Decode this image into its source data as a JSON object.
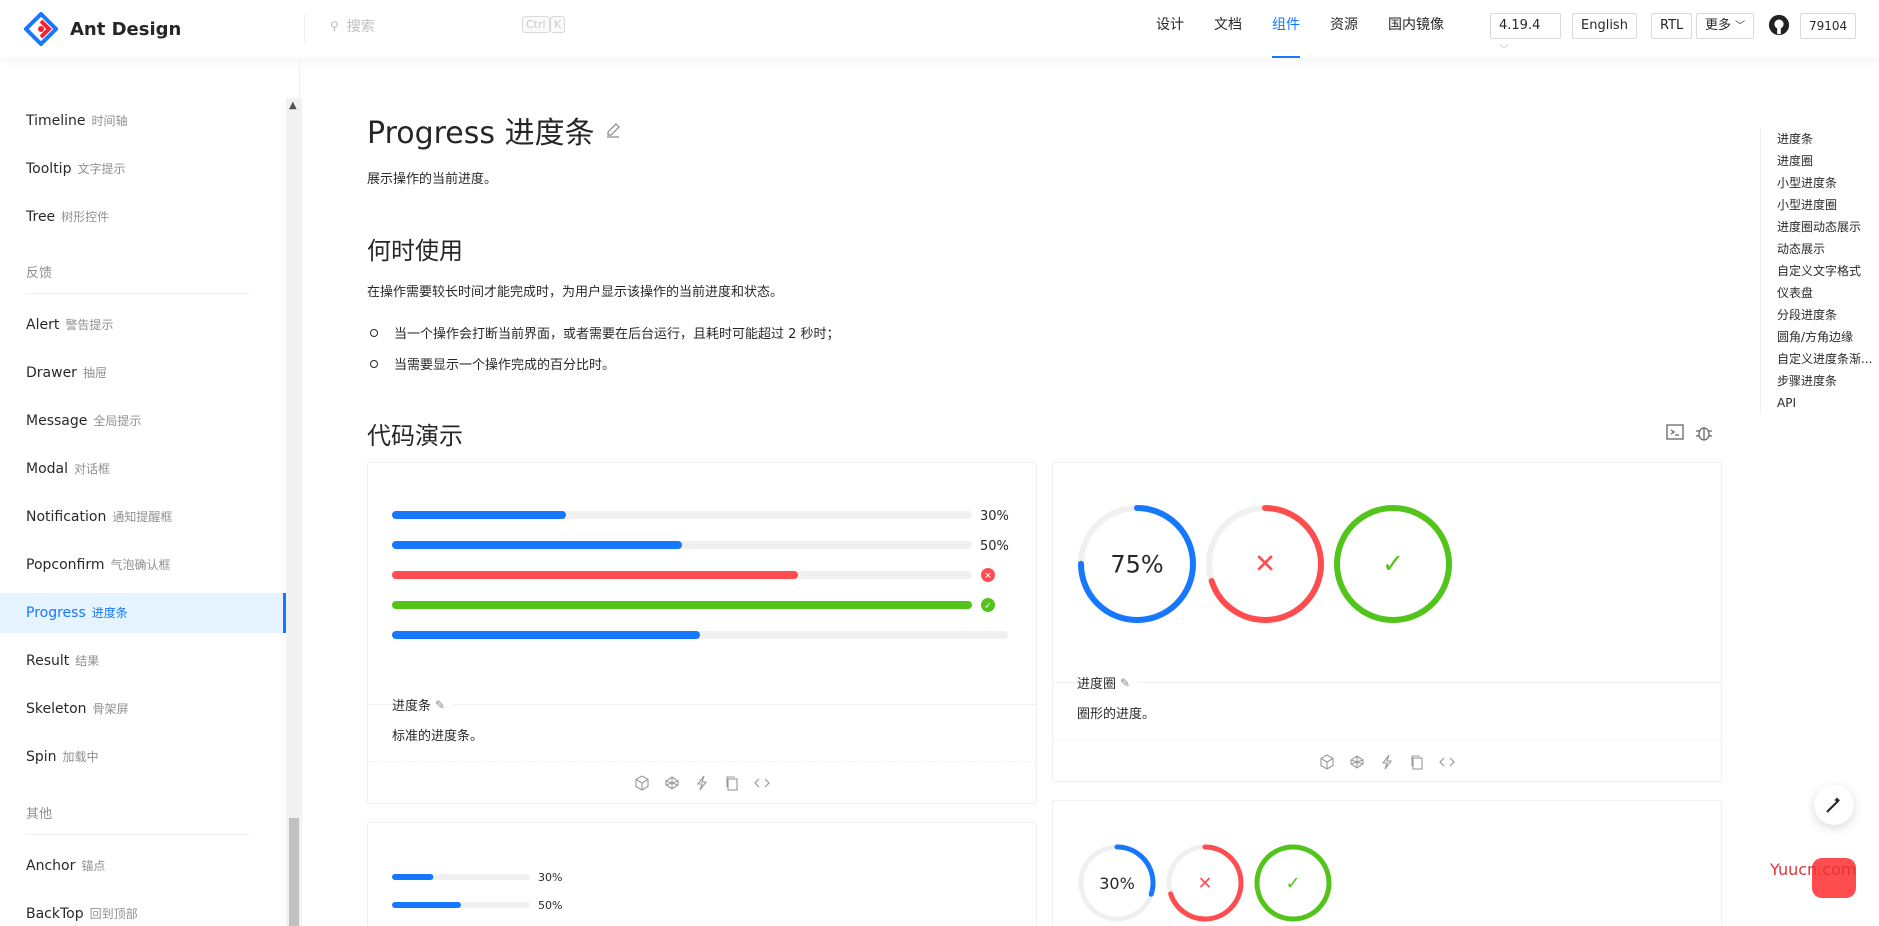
{
  "header": {
    "logo_text": "Ant Design",
    "search_placeholder": "搜索",
    "search_key_ctrl": "Ctrl",
    "search_key_k": "K",
    "nav": [
      "设计",
      "文档",
      "组件",
      "资源",
      "国内镜像"
    ],
    "nav_active_index": 2,
    "version": "4.19.4",
    "lang": "English",
    "rtl": "RTL",
    "more": "更多",
    "github_stars": "79104"
  },
  "sidebar": {
    "items": [
      {
        "en": "Timeline",
        "cn": "时间轴"
      },
      {
        "en": "Tooltip",
        "cn": "文字提示"
      },
      {
        "en": "Tree",
        "cn": "树形控件"
      },
      {
        "group": "反馈"
      },
      {
        "en": "Alert",
        "cn": "警告提示"
      },
      {
        "en": "Drawer",
        "cn": "抽屉"
      },
      {
        "en": "Message",
        "cn": "全局提示"
      },
      {
        "en": "Modal",
        "cn": "对话框"
      },
      {
        "en": "Notification",
        "cn": "通知提醒框"
      },
      {
        "en": "Popconfirm",
        "cn": "气泡确认框"
      },
      {
        "en": "Progress",
        "cn": "进度条",
        "active": true
      },
      {
        "en": "Result",
        "cn": "结果"
      },
      {
        "en": "Skeleton",
        "cn": "骨架屏"
      },
      {
        "en": "Spin",
        "cn": "加载中"
      },
      {
        "group": "其他"
      },
      {
        "en": "Anchor",
        "cn": "锚点"
      },
      {
        "en": "BackTop",
        "cn": "回到顶部"
      }
    ]
  },
  "main": {
    "title": "Progress 进度条",
    "description": "展示操作的当前进度。",
    "when_title": "何时使用",
    "when_text": "在操作需要较长时间才能完成时，为用户显示该操作的当前进度和状态。",
    "when_list": [
      "当一个操作会打断当前界面，或者需要在后台运行，且耗时可能超过 2 秒时；",
      "当需要显示一个操作完成的百分比时。"
    ],
    "demo_title": "代码演示"
  },
  "demos": {
    "line": {
      "title": "进度条",
      "desc": "标准的进度条。",
      "bars": [
        {
          "percent": 30,
          "status": "normal",
          "label": "30%",
          "color": "#1677ff"
        },
        {
          "percent": 50,
          "status": "active",
          "label": "50%",
          "color": "#1677ff"
        },
        {
          "percent": 70,
          "status": "exception",
          "label": "",
          "color": "#ff4d4f"
        },
        {
          "percent": 100,
          "status": "success",
          "label": "",
          "color": "#52c41a"
        },
        {
          "percent": 50,
          "status": "no-info",
          "label": "",
          "color": "#1677ff"
        }
      ]
    },
    "circle": {
      "title": "进度圈",
      "desc": "圈形的进度。",
      "circles": [
        {
          "percent": 75,
          "label": "75%",
          "status": "normal",
          "color": "#1677ff"
        },
        {
          "percent": 70,
          "label": "✕",
          "status": "exception",
          "color": "#ff4d4f"
        },
        {
          "percent": 100,
          "label": "✓",
          "status": "success",
          "color": "#52c41a"
        }
      ]
    },
    "mini_line": {
      "bars": [
        {
          "percent": 30,
          "label": "30%"
        },
        {
          "percent": 50,
          "label": "50%"
        }
      ]
    },
    "mini_circle": {
      "circles": [
        {
          "percent": 30,
          "label": "30%",
          "color": "#1677ff"
        },
        {
          "percent": 70,
          "label": "✕",
          "color": "#ff4d4f"
        },
        {
          "percent": 100,
          "label": "✓",
          "color": "#52c41a"
        }
      ]
    }
  },
  "toc": [
    "进度条",
    "进度圈",
    "小型进度条",
    "小型进度圈",
    "进度圈动态展示",
    "动态展示",
    "自定义文字格式",
    "仪表盘",
    "分段进度条",
    "圆角/方角边缘",
    "自定义进度条渐...",
    "步骤进度条",
    "API"
  ],
  "watermark": "Yuucn.com"
}
